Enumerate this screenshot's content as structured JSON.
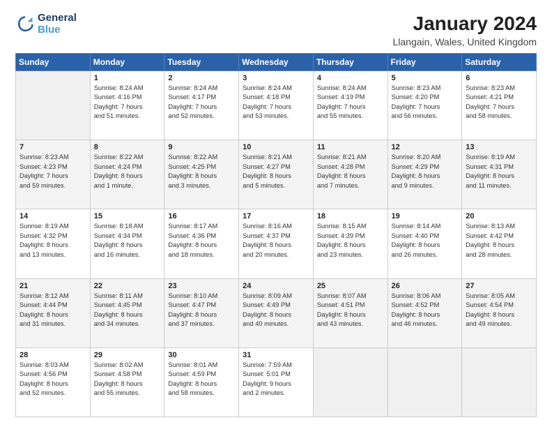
{
  "header": {
    "logo_line1": "General",
    "logo_line2": "Blue",
    "title": "January 2024",
    "subtitle": "Llangain, Wales, United Kingdom"
  },
  "days_of_week": [
    "Sunday",
    "Monday",
    "Tuesday",
    "Wednesday",
    "Thursday",
    "Friday",
    "Saturday"
  ],
  "weeks": [
    [
      {
        "day": "",
        "content": ""
      },
      {
        "day": "1",
        "content": "Sunrise: 8:24 AM\nSunset: 4:16 PM\nDaylight: 7 hours\nand 51 minutes."
      },
      {
        "day": "2",
        "content": "Sunrise: 8:24 AM\nSunset: 4:17 PM\nDaylight: 7 hours\nand 52 minutes."
      },
      {
        "day": "3",
        "content": "Sunrise: 8:24 AM\nSunset: 4:18 PM\nDaylight: 7 hours\nand 53 minutes."
      },
      {
        "day": "4",
        "content": "Sunrise: 8:24 AM\nSunset: 4:19 PM\nDaylight: 7 hours\nand 55 minutes."
      },
      {
        "day": "5",
        "content": "Sunrise: 8:23 AM\nSunset: 4:20 PM\nDaylight: 7 hours\nand 56 minutes."
      },
      {
        "day": "6",
        "content": "Sunrise: 8:23 AM\nSunset: 4:21 PM\nDaylight: 7 hours\nand 58 minutes."
      }
    ],
    [
      {
        "day": "7",
        "content": "Sunrise: 8:23 AM\nSunset: 4:23 PM\nDaylight: 7 hours\nand 59 minutes."
      },
      {
        "day": "8",
        "content": "Sunrise: 8:22 AM\nSunset: 4:24 PM\nDaylight: 8 hours\nand 1 minute."
      },
      {
        "day": "9",
        "content": "Sunrise: 8:22 AM\nSunset: 4:25 PM\nDaylight: 8 hours\nand 3 minutes."
      },
      {
        "day": "10",
        "content": "Sunrise: 8:21 AM\nSunset: 4:27 PM\nDaylight: 8 hours\nand 5 minutes."
      },
      {
        "day": "11",
        "content": "Sunrise: 8:21 AM\nSunset: 4:28 PM\nDaylight: 8 hours\nand 7 minutes."
      },
      {
        "day": "12",
        "content": "Sunrise: 8:20 AM\nSunset: 4:29 PM\nDaylight: 8 hours\nand 9 minutes."
      },
      {
        "day": "13",
        "content": "Sunrise: 8:19 AM\nSunset: 4:31 PM\nDaylight: 8 hours\nand 11 minutes."
      }
    ],
    [
      {
        "day": "14",
        "content": "Sunrise: 8:19 AM\nSunset: 4:32 PM\nDaylight: 8 hours\nand 13 minutes."
      },
      {
        "day": "15",
        "content": "Sunrise: 8:18 AM\nSunset: 4:34 PM\nDaylight: 8 hours\nand 16 minutes."
      },
      {
        "day": "16",
        "content": "Sunrise: 8:17 AM\nSunset: 4:36 PM\nDaylight: 8 hours\nand 18 minutes."
      },
      {
        "day": "17",
        "content": "Sunrise: 8:16 AM\nSunset: 4:37 PM\nDaylight: 8 hours\nand 20 minutes."
      },
      {
        "day": "18",
        "content": "Sunrise: 8:15 AM\nSunset: 4:39 PM\nDaylight: 8 hours\nand 23 minutes."
      },
      {
        "day": "19",
        "content": "Sunrise: 8:14 AM\nSunset: 4:40 PM\nDaylight: 8 hours\nand 26 minutes."
      },
      {
        "day": "20",
        "content": "Sunrise: 8:13 AM\nSunset: 4:42 PM\nDaylight: 8 hours\nand 28 minutes."
      }
    ],
    [
      {
        "day": "21",
        "content": "Sunrise: 8:12 AM\nSunset: 4:44 PM\nDaylight: 8 hours\nand 31 minutes."
      },
      {
        "day": "22",
        "content": "Sunrise: 8:11 AM\nSunset: 4:45 PM\nDaylight: 8 hours\nand 34 minutes."
      },
      {
        "day": "23",
        "content": "Sunrise: 8:10 AM\nSunset: 4:47 PM\nDaylight: 8 hours\nand 37 minutes."
      },
      {
        "day": "24",
        "content": "Sunrise: 8:09 AM\nSunset: 4:49 PM\nDaylight: 8 hours\nand 40 minutes."
      },
      {
        "day": "25",
        "content": "Sunrise: 8:07 AM\nSunset: 4:51 PM\nDaylight: 8 hours\nand 43 minutes."
      },
      {
        "day": "26",
        "content": "Sunrise: 8:06 AM\nSunset: 4:52 PM\nDaylight: 8 hours\nand 46 minutes."
      },
      {
        "day": "27",
        "content": "Sunrise: 8:05 AM\nSunset: 4:54 PM\nDaylight: 8 hours\nand 49 minutes."
      }
    ],
    [
      {
        "day": "28",
        "content": "Sunrise: 8:03 AM\nSunset: 4:56 PM\nDaylight: 8 hours\nand 52 minutes."
      },
      {
        "day": "29",
        "content": "Sunrise: 8:02 AM\nSunset: 4:58 PM\nDaylight: 8 hours\nand 55 minutes."
      },
      {
        "day": "30",
        "content": "Sunrise: 8:01 AM\nSunset: 4:59 PM\nDaylight: 8 hours\nand 58 minutes."
      },
      {
        "day": "31",
        "content": "Sunrise: 7:59 AM\nSunset: 5:01 PM\nDaylight: 9 hours\nand 2 minutes."
      },
      {
        "day": "",
        "content": ""
      },
      {
        "day": "",
        "content": ""
      },
      {
        "day": "",
        "content": ""
      }
    ]
  ]
}
